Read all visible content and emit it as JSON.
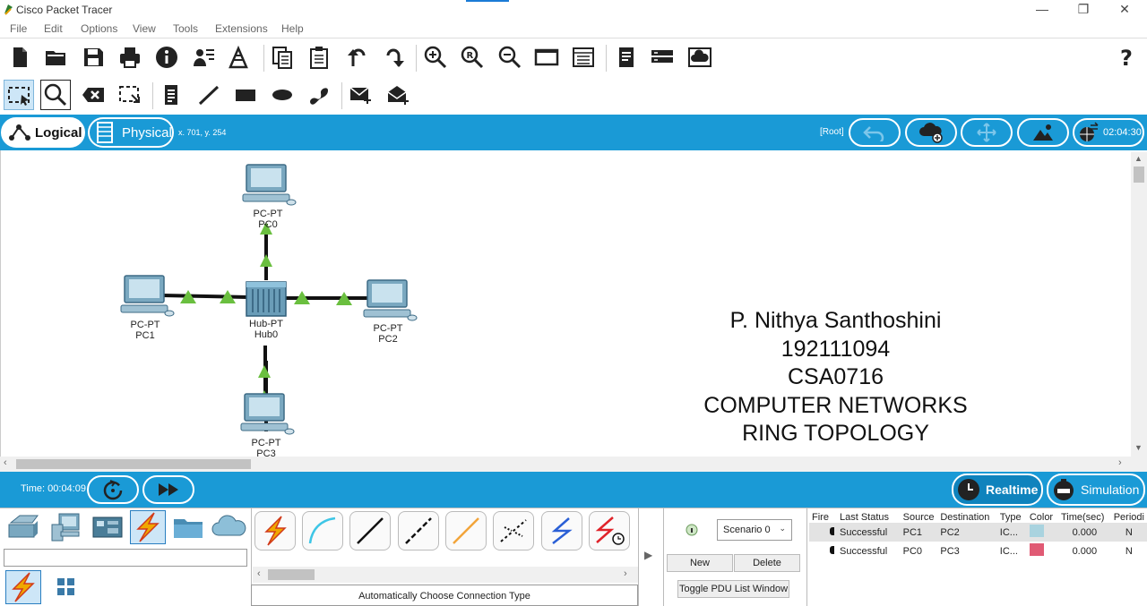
{
  "window": {
    "title": "Cisco Packet Tracer"
  },
  "menu": [
    "File",
    "Edit",
    "Options",
    "View",
    "Tools",
    "Extensions",
    "Help"
  ],
  "toolbar1_icons": [
    "new-file-icon",
    "open-folder-icon",
    "save-icon",
    "print-icon",
    "info-icon",
    "activity-wizard-icon",
    "network-info-icon",
    "copy-icon",
    "paste-icon",
    "undo-icon",
    "redo-icon",
    "zoom-in-icon",
    "zoom-reset-icon",
    "zoom-out-icon",
    "drawing-palette-icon",
    "custom-device-icon",
    "notes-icon",
    "device-list-icon",
    "cloud-icon",
    "help-icon"
  ],
  "toolbar2_icons": [
    "select-icon",
    "inspect-icon",
    "delete-icon",
    "resize-icon",
    "note-icon",
    "line-icon",
    "rectangle-icon",
    "ellipse-icon",
    "freeform-icon",
    "add-simple-pdu-icon",
    "add-complex-pdu-icon"
  ],
  "modebar": {
    "logical": "Logical",
    "physical": "Physical",
    "coords": "x. 701, y. 254",
    "root": "[Root]",
    "clock": "02:04:30"
  },
  "topology": {
    "devices": [
      {
        "type": "PC-PT",
        "name": "PC0"
      },
      {
        "type": "PC-PT",
        "name": "PC1"
      },
      {
        "type": "PC-PT",
        "name": "PC2"
      },
      {
        "type": "PC-PT",
        "name": "PC3"
      },
      {
        "type": "Hub-PT",
        "name": "Hub0"
      }
    ]
  },
  "note_lines": [
    "P. Nithya Santhoshini",
    "192111094",
    "CSA0716",
    "COMPUTER NETWORKS",
    "RING TOPOLOGY"
  ],
  "timebar": {
    "time": "Time: 00:04:09",
    "realtime": "Realtime",
    "simulation": "Simulation"
  },
  "bottom": {
    "connection_label": "Automatically Choose Connection Type",
    "scenario": "Scenario 0",
    "new_btn": "New",
    "delete_btn": "Delete",
    "toggle_btn": "Toggle PDU List Window",
    "pdu_headers": [
      "Fire",
      "Last Status",
      "Source",
      "Destination",
      "Type",
      "Color",
      "Time(sec)",
      "Periodi"
    ],
    "pdu_rows": [
      {
        "status": "Successful",
        "source": "PC1",
        "dest": "PC2",
        "type": "IC...",
        "color": "#a9d3df",
        "time": "0.000",
        "periodic": "N"
      },
      {
        "status": "Successful",
        "source": "PC0",
        "dest": "PC3",
        "type": "IC...",
        "color": "#e05a74",
        "time": "0.000",
        "periodic": "N"
      }
    ]
  },
  "colors": {
    "accent": "#1a9ad6",
    "link_up": "#6abf3f",
    "lightning": "#f0a800"
  }
}
